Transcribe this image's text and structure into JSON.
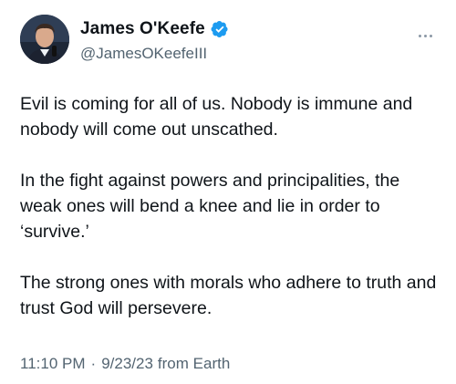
{
  "author": {
    "display_name": "James O'Keefe",
    "handle": "@JamesOKeefeIII",
    "verified": true,
    "verified_color": "#1d9bf0"
  },
  "menu": {
    "icon": "more-horizontal-icon"
  },
  "tweet": {
    "paragraphs": [
      "Evil is coming for all of us. Nobody is immune and nobody will come out unscathed.",
      "In the fight against powers and principalities, the weak ones will bend a knee and lie in order to ‘survive.’",
      "The strong ones with morals who adhere to truth and trust God will persevere."
    ]
  },
  "meta": {
    "time": "11:10 PM",
    "separator": "·",
    "date": "9/23/23",
    "source": "from Earth"
  }
}
